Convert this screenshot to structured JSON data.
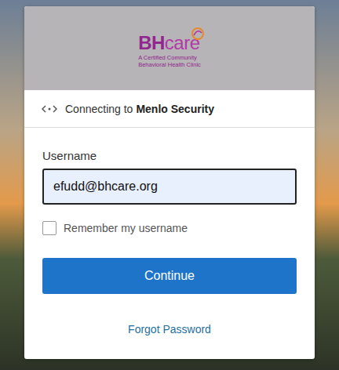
{
  "logo": {
    "primary": "BH",
    "secondary": "care",
    "tagline": [
      "A Certified Community",
      "Behavioral Health Clinic"
    ]
  },
  "connection": {
    "prefix": "Connecting to",
    "target": "Menlo Security"
  },
  "form": {
    "username_label": "Username",
    "username_value": "efudd@bhcare.org",
    "remember": {
      "label": "Remember my username",
      "checked": false
    },
    "submit": "Continue",
    "forgot": "Forgot Password"
  }
}
